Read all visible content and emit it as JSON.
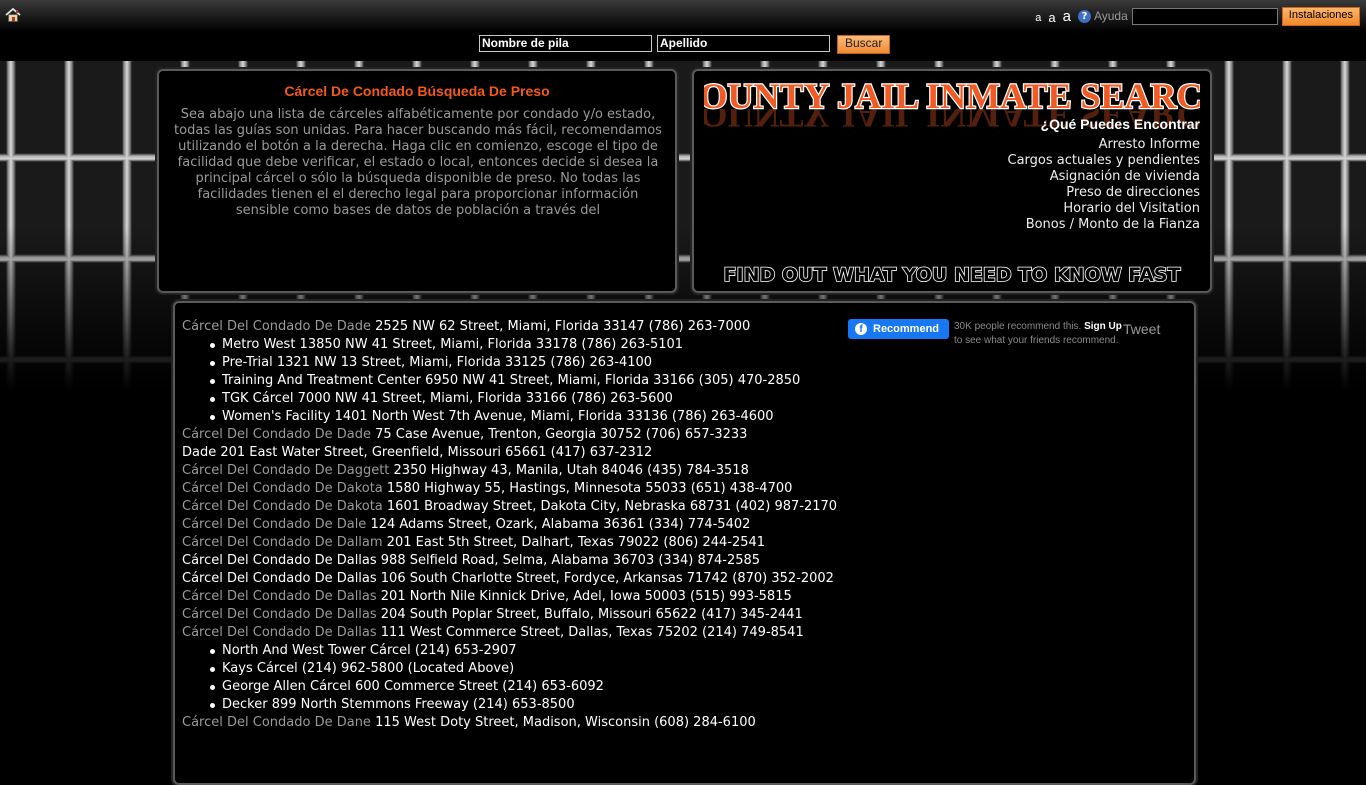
{
  "topbar": {
    "font_sizes": [
      "a",
      "a",
      "a"
    ],
    "help_icon": "?",
    "help_label": "Ayuda",
    "install_label": "Instalaciones"
  },
  "search": {
    "first_name": "Nombre de pila",
    "last_name": "Apellido",
    "button": "Buscar"
  },
  "left_panel": {
    "title": "Cárcel De Condado Búsqueda De Preso",
    "text": "Sea abajo una lista de cárceles alfabéticamente por condado y/o estado, todas las guías son unidas. Para hacer buscando más fácil, recomendamos utilizando el botón a la derecha. Haga clic en comienzo, escoge el tipo de facilidad que debe verificar, el estado o local, entonces decide si desea la principal cárcel o sólo la búsqueda disponible de preso. No todas las facilidades tienen el el derecho legal para proporcionar información sensible como bases de datos de población a través del"
  },
  "right_panel": {
    "logo": "COUNTY JAIL INMATE SEARCH",
    "heading": "¿Qué Puedes Encontrar",
    "items": [
      "Arresto Informe",
      "Cargos actuales y pendientes",
      "Asignación de vivienda",
      "Preso de direcciones",
      "Horario del Visitation",
      "Bonos / Monto de la Fianza"
    ],
    "tagline": "FIND OUT WHAT YOU NEED TO KNOW FAST"
  },
  "social": {
    "fb_logo": "f",
    "recommend_label": "Recommend",
    "recommend_count": "30K people recommend this.",
    "signup": "Sign Up",
    "signup_rest": "to see what your friends recommend.",
    "tweet": "Tweet"
  },
  "listing": [
    {
      "type": "main",
      "name": "Cárcel Del Condado De Dade",
      "rest": " 2525 NW 62 Street, Miami, Florida 33147 (786) 263-7000",
      "name_white": false
    },
    {
      "type": "sub",
      "text": "Metro West 13850 NW 41 Street, Miami, Florida 33178 (786) 263-5101"
    },
    {
      "type": "sub",
      "text": "Pre-Trial 1321 NW 13 Street, Miami, Florida 33125 (786) 263-4100"
    },
    {
      "type": "sub",
      "text": "Training And Treatment Center 6950 NW 41 Street, Miami, Florida 33166 (305) 470-2850"
    },
    {
      "type": "sub",
      "text": "TGK Cárcel 7000 NW 41 Street, Miami, Florida 33166 (786) 263-5600"
    },
    {
      "type": "sub",
      "text": "Women's Facility 1401 North West 7th Avenue, Miami, Florida 33136 (786) 263-4600"
    },
    {
      "type": "main",
      "name": "Cárcel Del Condado De Dade",
      "rest": " 75 Case Avenue, Trenton, Georgia 30752 (706) 657-3233",
      "name_white": false
    },
    {
      "type": "main",
      "name": "Dade",
      "rest": " 201 East Water Street, Greenfield, Missouri 65661 (417) 637-2312",
      "name_white": true
    },
    {
      "type": "main",
      "name": "Cárcel Del Condado De Daggett",
      "rest": " 2350 Highway 43, Manila, Utah 84046 (435) 784-3518",
      "name_white": false
    },
    {
      "type": "main",
      "name": "Cárcel Del Condado De Dakota",
      "rest": " 1580 Highway 55, Hastings, Minnesota 55033 (651) 438-4700",
      "name_white": false
    },
    {
      "type": "main",
      "name": "Cárcel Del Condado De Dakota",
      "rest": " 1601 Broadway Street, Dakota City, Nebraska 68731 (402) 987-2170",
      "name_white": false
    },
    {
      "type": "main",
      "name": "Cárcel Del Condado De Dale",
      "rest": " 124 Adams Street, Ozark, Alabama 36361 (334) 774-5402",
      "name_white": false
    },
    {
      "type": "main",
      "name": "Cárcel Del Condado De Dallam",
      "rest": " 201 East 5th Street, Dalhart, Texas 79022 (806) 244-2541",
      "name_white": false
    },
    {
      "type": "main",
      "name": "Cárcel Del Condado De Dallas",
      "rest": " 988 Selfield Road, Selma, Alabama 36703 (334) 874-2585",
      "name_white": true
    },
    {
      "type": "main",
      "name": "Cárcel Del Condado De Dallas",
      "rest": " 106 South Charlotte Street, Fordyce, Arkansas 71742 (870) 352-2002",
      "name_white": true
    },
    {
      "type": "main",
      "name": "Cárcel Del Condado De Dallas",
      "rest": " 201 North Nile Kinnick Drive, Adel, Iowa 50003 (515) 993-5815",
      "name_white": false
    },
    {
      "type": "main",
      "name": "Cárcel Del Condado De Dallas",
      "rest": " 204 South Poplar Street, Buffalo, Missouri 65622 (417) 345-2441",
      "name_white": false
    },
    {
      "type": "main",
      "name": "Cárcel Del Condado De Dallas",
      "rest": " 111 West Commerce Street, Dallas, Texas 75202 (214) 749-8541",
      "name_white": false
    },
    {
      "type": "sub",
      "text": "North And West Tower Cárcel (214) 653-2907"
    },
    {
      "type": "sub",
      "text": "Kays Cárcel (214) 962-5800 (Located Above)"
    },
    {
      "type": "sub",
      "text": "George Allen Cárcel 600 Commerce Street (214) 653-6092"
    },
    {
      "type": "sub",
      "text": "Decker 899 North Stemmons Freeway (214) 653-8500"
    },
    {
      "type": "main",
      "name": "Cárcel Del Condado De Dane",
      "rest": " 115 West Doty Street, Madison, Wisconsin (608) 284-6100",
      "name_white": false
    }
  ]
}
